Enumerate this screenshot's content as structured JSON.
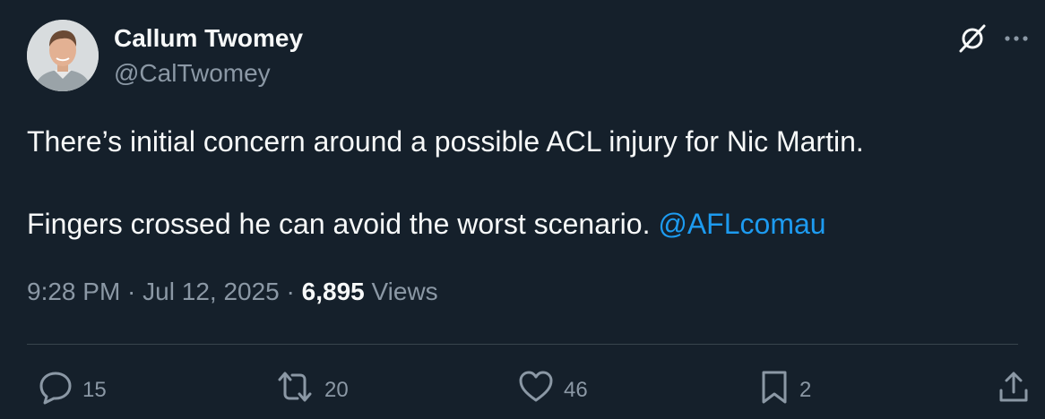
{
  "author": {
    "name": "Callum Twomey",
    "handle": "@CalTwomey"
  },
  "tweet": {
    "line1": "There’s initial concern around a possible ACL injury for Nic Martin.",
    "line2": "Fingers crossed he can avoid the worst scenario.",
    "mention": "@AFLcomau"
  },
  "meta": {
    "time": "9:28 PM",
    "sep1": " · ",
    "date": "Jul 12, 2025",
    "sep2": " · ",
    "views_count": "6,895",
    "views_label": " Views"
  },
  "actions": {
    "replies": "15",
    "reposts": "20",
    "likes": "46",
    "bookmarks": "2"
  },
  "icons": {
    "top": [
      "grok-icon",
      "more-icon"
    ],
    "actions": [
      "reply-icon",
      "repost-icon",
      "like-icon",
      "bookmark-icon",
      "share-icon"
    ]
  },
  "colors": {
    "background": "#15202b",
    "text": "#f7f9f9",
    "secondary": "#8b98a5",
    "link": "#1d9bf0",
    "divider": "#38444d"
  }
}
